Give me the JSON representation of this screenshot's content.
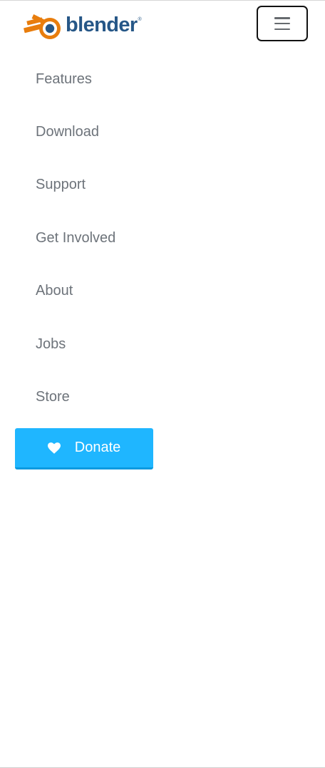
{
  "header": {
    "logo": {
      "wordmark": "blender",
      "registered": "®",
      "icon": "blender-logo-icon",
      "colors": {
        "orange": "#e87d0d",
        "blue": "#265787"
      }
    },
    "menu_toggle": {
      "icon": "hamburger-icon"
    }
  },
  "nav": {
    "items": [
      {
        "label": "Features"
      },
      {
        "label": "Download"
      },
      {
        "label": "Support"
      },
      {
        "label": "Get Involved"
      },
      {
        "label": "About"
      },
      {
        "label": "Jobs"
      },
      {
        "label": "Store"
      }
    ],
    "text_color": "#6d737a"
  },
  "donate": {
    "label": "Donate",
    "icon": "heart-icon",
    "background": "#1fb6ff"
  }
}
